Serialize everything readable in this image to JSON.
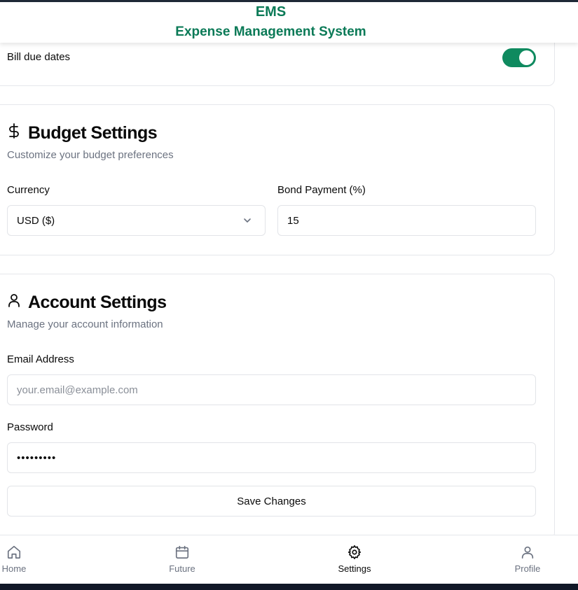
{
  "header": {
    "abbr": "EMS",
    "title": "Expense Management System",
    "accent_color": "#0b7a57"
  },
  "notifications": {
    "bill_due_dates_label": "Bill due dates",
    "bill_due_dates_enabled": true
  },
  "budget": {
    "icon": "dollar-icon",
    "title": "Budget Settings",
    "subtitle": "Customize your budget preferences",
    "currency_label": "Currency",
    "currency_value": "USD ($)",
    "bond_label": "Bond Payment (%)",
    "bond_value": "15"
  },
  "account": {
    "icon": "user-icon",
    "title": "Account Settings",
    "subtitle": "Manage your account information",
    "email_label": "Email Address",
    "email_placeholder": "your.email@example.com",
    "password_label": "Password",
    "password_value": "•••••••••",
    "save_label": "Save Changes"
  },
  "nav": {
    "items": [
      {
        "label": "Home",
        "icon": "home-icon",
        "active": false
      },
      {
        "label": "Future",
        "icon": "calendar-icon",
        "active": false
      },
      {
        "label": "Settings",
        "icon": "gear-icon",
        "active": true
      },
      {
        "label": "Profile",
        "icon": "user-icon",
        "active": false
      }
    ]
  }
}
